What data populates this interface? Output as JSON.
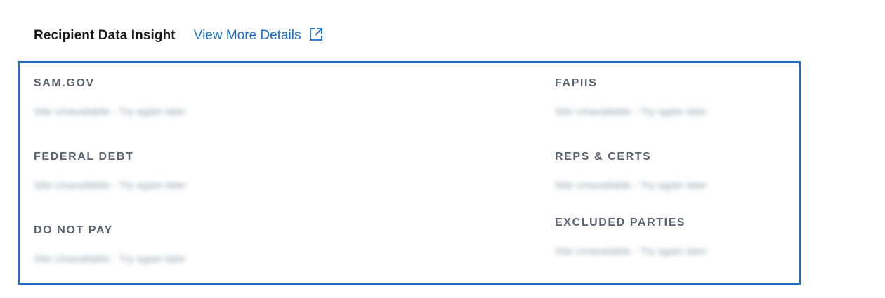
{
  "header": {
    "title": "Recipient Data Insight",
    "link_label": "View More Details",
    "link_icon": "external-link-icon"
  },
  "colors": {
    "accent": "#1a6fc9",
    "label": "#5c6470",
    "title": "#1b1b1b"
  },
  "left_fields": [
    {
      "label": "SAM.GOV",
      "value": "Site Unavailable - Try again later"
    },
    {
      "label": "FEDERAL DEBT",
      "value": "Site Unavailable - Try again later"
    },
    {
      "label": "DO NOT PAY",
      "value": "Site Unavailable - Try again later"
    }
  ],
  "right_fields": [
    {
      "label": "FAPIIS",
      "value": "Site Unavailable - Try again later"
    },
    {
      "label": "REPS & CERTS",
      "value": "Site Unavailable - Try again later"
    },
    {
      "label": "EXCLUDED PARTIES",
      "value": "Site Unavailable - Try again later"
    }
  ]
}
